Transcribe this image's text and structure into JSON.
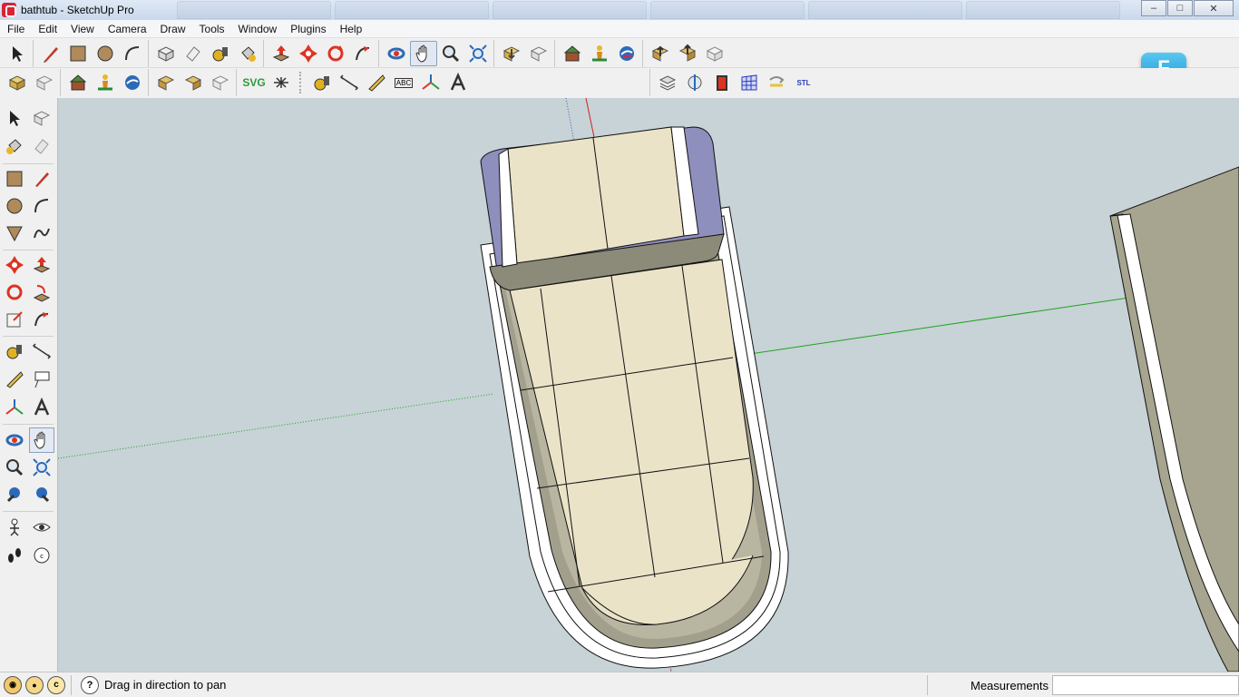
{
  "window": {
    "title": "bathtub - SketchUp Pro",
    "minimize": "–",
    "maximize": "□",
    "close": "✕"
  },
  "menu": [
    "File",
    "Edit",
    "View",
    "Camera",
    "Draw",
    "Tools",
    "Window",
    "Plugins",
    "Help"
  ],
  "toolbar": {
    "svg_label": "SVG",
    "stl_label": "STL",
    "abc_label": "ABC"
  },
  "logo": {
    "letter": "F"
  },
  "status": {
    "message": "Drag in direction to pan",
    "help_glyph": "?",
    "measurements_label": "Measurements",
    "measurements_value": ""
  },
  "colors": {
    "viewport_bg": "#c7d3d6",
    "model_face": "#ebe3c8",
    "model_shadow": "#a29f8c",
    "edge": "#000000",
    "green_axis": "#1fa21f",
    "red_axis": "#cc2222",
    "blue_axis": "#3a54c6"
  }
}
